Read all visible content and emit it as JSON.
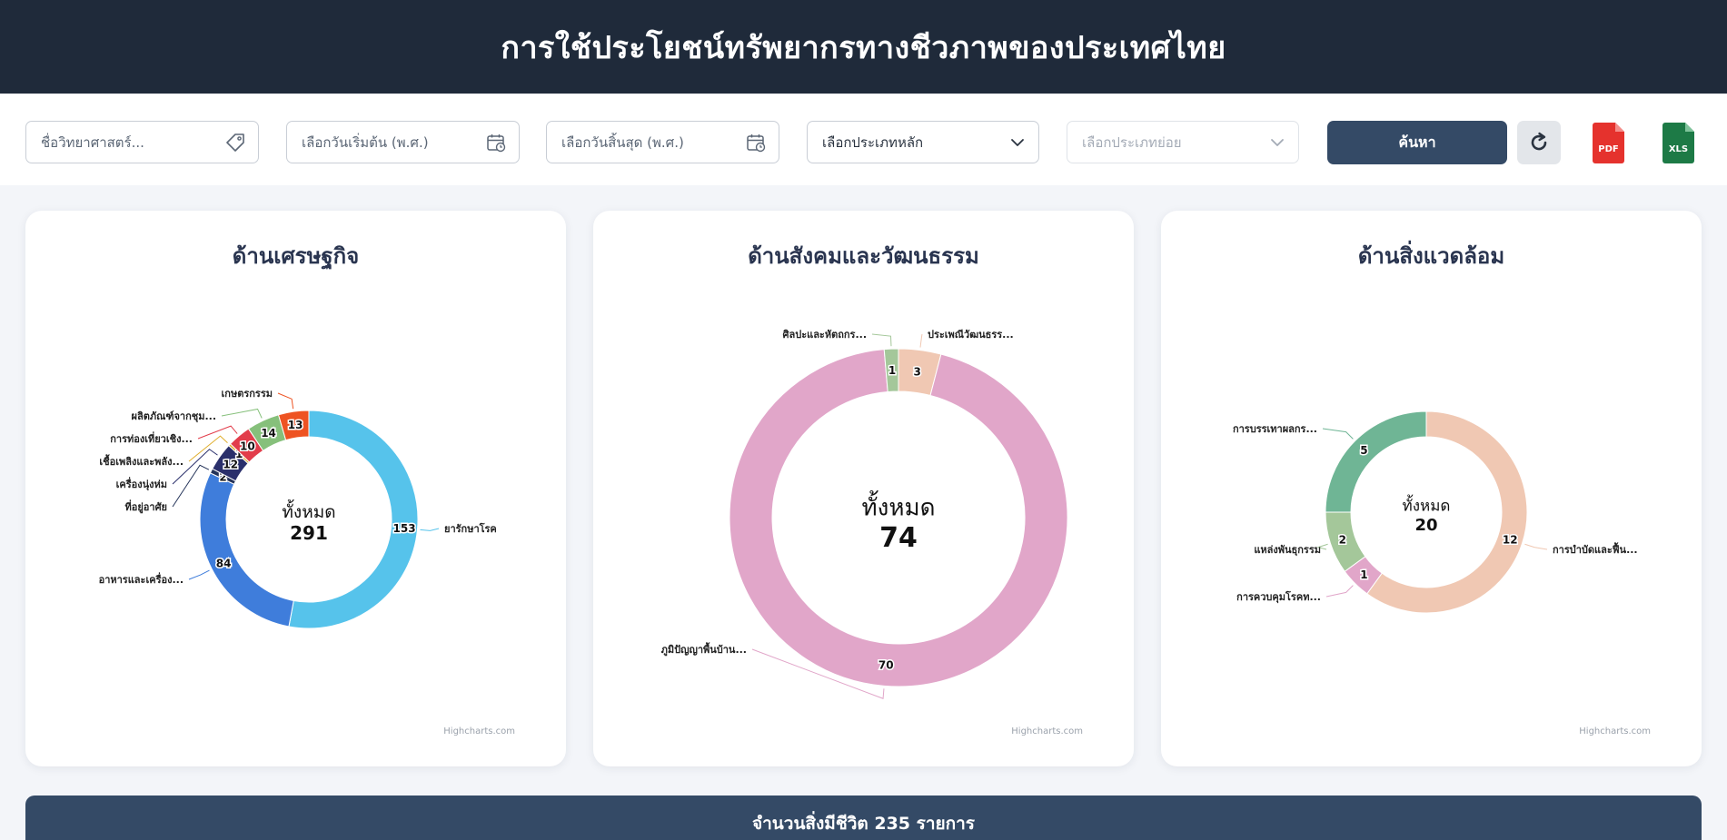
{
  "header": {
    "title": "การใช้ประโยชน์ทรัพยากรทางชีวภาพของประเทศไทย"
  },
  "filters": {
    "scientific_name_placeholder": "ชื่อวิทยาศาสตร์...",
    "start_date_placeholder": "เลือกวันเริ่มต้น (พ.ศ.)",
    "end_date_placeholder": "เลือกวันสิ้นสุด (พ.ศ.)",
    "main_category_value": "เลือกประเภทหลัก",
    "sub_category_placeholder": "เลือกประเภทย่อย",
    "search_label": "ค้นหา",
    "pdf_label": "PDF",
    "xls_label": "XLS"
  },
  "colors": {
    "header_bg": "#1f2a3a",
    "accent": "#344a66",
    "pdf": "#e5322d",
    "xls": "#1d7a46"
  },
  "icons": {
    "scientific_name": "tag-icon",
    "start_date": "calendar-icon",
    "end_date": "calendar-icon",
    "main_category": "chevron-down-icon",
    "sub_category": "chevron-down-icon",
    "reset": "refresh-icon",
    "pdf": "pdf-file-icon",
    "xls": "xls-file-icon"
  },
  "chart_data": [
    {
      "type": "pie",
      "title": "ด้านเศรษฐกิจ",
      "center_label": "ทั้งหมด",
      "total": 291,
      "credit": "Highcharts.com",
      "slices": [
        {
          "name": "ยารักษาโรค",
          "value": 153,
          "color": "#56c3eb"
        },
        {
          "name": "อาหารและเครื่อง...",
          "value": 84,
          "color": "#3f7ddb"
        },
        {
          "name": "ที่อยู่อาศัย",
          "value": 2,
          "color": "#243359"
        },
        {
          "name": "เครื่องนุ่งห่ม",
          "value": 12,
          "color": "#2a2f6b"
        },
        {
          "name": "เชื้อเพลิงและพลัง...",
          "value": 1,
          "color": "#e0ae2c"
        },
        {
          "name": "การท่องเที่ยวเชิง...",
          "value": 10,
          "color": "#e23d4b"
        },
        {
          "name": "ผลิตภัณฑ์จากชุม...",
          "value": 14,
          "color": "#86c07b"
        },
        {
          "name": "เกษตรกรรม",
          "value": 13,
          "color": "#ee5322"
        }
      ]
    },
    {
      "type": "pie",
      "title": "ด้านสังคมและวัฒนธรรม",
      "center_label": "ทั้งหมด",
      "total": 74,
      "credit": "Highcharts.com",
      "slices": [
        {
          "name": "ประเพณีวัฒนธรร...",
          "value": 3,
          "color": "#f0c8b3"
        },
        {
          "name": "ภูมิปัญญาพื้นบ้าน...",
          "value": 70,
          "color": "#e1a6c9"
        },
        {
          "name": "ศิลปะและหัตถกร...",
          "value": 1,
          "color": "#a4c79a"
        }
      ]
    },
    {
      "type": "pie",
      "title": "ด้านสิ่งแวดล้อม",
      "center_label": "ทั้งหมด",
      "total": 20,
      "credit": "Highcharts.com",
      "slices": [
        {
          "name": "การบำบัดและฟื้น...",
          "value": 12,
          "color": "#f0c8b3"
        },
        {
          "name": "การควบคุมโรคท...",
          "value": 1,
          "color": "#e1a6c9"
        },
        {
          "name": "แหล่งพันธุกรรม",
          "value": 2,
          "color": "#a4c79a"
        },
        {
          "name": "การบรรเทาผลกร...",
          "value": 5,
          "color": "#6fb595"
        }
      ]
    }
  ],
  "footer": {
    "summary": "จำนวนสิ่งมีชีวิต 235 รายการ"
  }
}
